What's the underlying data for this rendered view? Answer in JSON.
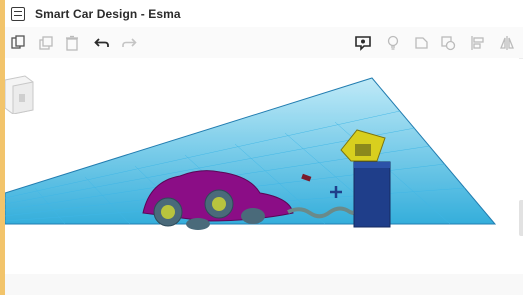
{
  "window": {
    "title": "Smart Car Design - Esma"
  },
  "toolbar": {
    "buttons": [
      {
        "name": "copy-icon"
      },
      {
        "name": "duplicate-icon"
      },
      {
        "name": "delete-icon"
      },
      {
        "name": "undo-icon"
      },
      {
        "name": "redo-icon"
      },
      {
        "name": "notes-icon"
      },
      {
        "name": "light-icon"
      },
      {
        "name": "shape-icon"
      },
      {
        "name": "group-icon"
      },
      {
        "name": "align-icon"
      },
      {
        "name": "mirror-icon"
      }
    ]
  },
  "colors": {
    "workplane": "#1fa6d8",
    "workplane_edge": "#0b6fa8",
    "car_body": "#8b0d86",
    "wheels": "#4a6a7a",
    "tower": "#1f3e8a",
    "tower_top": "#d8cf1e",
    "cable": "#6a8a8a"
  }
}
